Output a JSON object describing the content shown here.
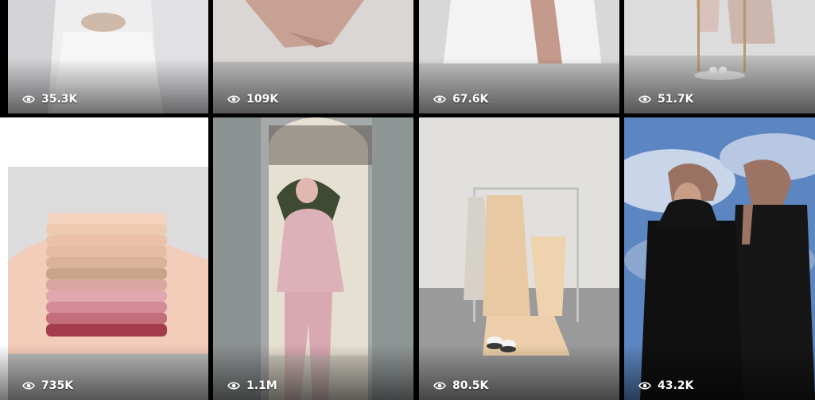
{
  "tiles": [
    {
      "views": "35.3K",
      "icon": "eye-icon",
      "photo": "white-pleated-dress"
    },
    {
      "views": "109K",
      "icon": "eye-icon",
      "photo": "folded-pink-fabric"
    },
    {
      "views": "67.6K",
      "icon": "eye-icon",
      "photo": "white-outfit-pink-scarf"
    },
    {
      "views": "51.7K",
      "icon": "eye-icon",
      "photo": "clothing-rack-shoes"
    },
    {
      "views": "735K",
      "icon": "eye-icon",
      "photo": "stacked-hijabs"
    },
    {
      "views": "1.1M",
      "icon": "eye-icon",
      "photo": "woman-pink-set"
    },
    {
      "views": "80.5K",
      "icon": "eye-icon",
      "photo": "rack-beige-dresses"
    },
    {
      "views": "43.2K",
      "icon": "eye-icon",
      "photo": "two-women-black-abaya"
    }
  ],
  "colors": {
    "overlay_text": "#ffffff",
    "grid_gap": "#000000"
  }
}
